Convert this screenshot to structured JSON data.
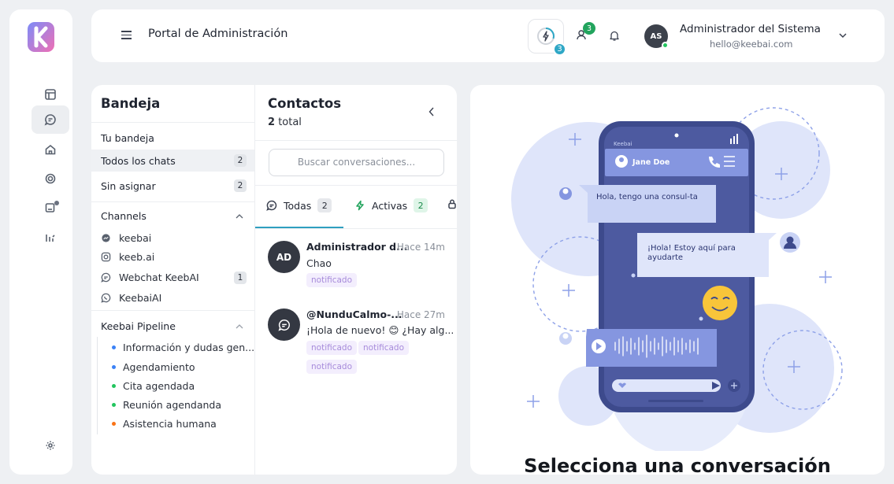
{
  "header": {
    "title": "Portal de Administración",
    "bolt_badge": "3",
    "users_badge": "3",
    "user_initials": "AS",
    "user_name": "Administrador del Sistema",
    "user_email": "hello@keebai.com"
  },
  "rail": {
    "items": [
      "table-icon",
      "chat-icon",
      "home-icon",
      "openai-icon",
      "device-icon",
      "analytics-icon"
    ],
    "bottom": "settings-icon"
  },
  "inbox": {
    "title": "Bandeja",
    "items": [
      {
        "label": "Tu bandeja",
        "count": ""
      },
      {
        "label": "Todos los chats",
        "count": "2"
      },
      {
        "label": "Sin asignar",
        "count": "2"
      }
    ],
    "channels_label": "Channels",
    "channels": [
      {
        "label": "keebai",
        "icon": "messenger-icon",
        "count": ""
      },
      {
        "label": "keeb.ai",
        "icon": "instagram-icon",
        "count": ""
      },
      {
        "label": "Webchat KeebAI",
        "icon": "webchat-icon",
        "count": "1"
      },
      {
        "label": "KeebaiAI",
        "icon": "whatsapp-icon",
        "count": ""
      }
    ],
    "pipeline_label": "Keebai Pipeline",
    "pipeline": [
      {
        "label": "Información y dudas gen...",
        "color": "#3b82f6"
      },
      {
        "label": "Agendamiento",
        "color": "#3b82f6"
      },
      {
        "label": "Cita agendada",
        "color": "#22c55e"
      },
      {
        "label": "Reunión agendanda",
        "color": "#22c55e"
      },
      {
        "label": "Asistencia humana",
        "color": "#f97316"
      }
    ]
  },
  "contacts": {
    "title": "Contactos",
    "total_count": "2",
    "total_label": "total",
    "search_placeholder": "Buscar conversaciones...",
    "tabs": [
      {
        "label": "Todas",
        "count": "2"
      },
      {
        "label": "Activas",
        "count": "2"
      }
    ],
    "conversations": [
      {
        "initials": "AD",
        "name": "Administrador d...",
        "time": "Hace 14m",
        "message": "Chao",
        "tags": [
          "notificado"
        ]
      },
      {
        "initials": "",
        "name": "@NunduCalmo-...",
        "time": "Hace 27m",
        "message": "¡Hola de nuevo! 😊 ¿Hay alg...",
        "tags": [
          "notificado",
          "notificado",
          "notificado"
        ]
      }
    ]
  },
  "empty_state": {
    "title": "Selecciona una conversación",
    "phone_app": "Keebai",
    "phone_contact": "Jane Doe",
    "bubble_in": "Hola, tengo una consul-ta",
    "bubble_out": "¡Hola! Estoy aquí para ayudarte"
  },
  "colors": {
    "accent": "#2f9fbf",
    "badge_green": "#22a45d",
    "illustration": "#c9d3f5",
    "phone": "#3d4a8c"
  }
}
